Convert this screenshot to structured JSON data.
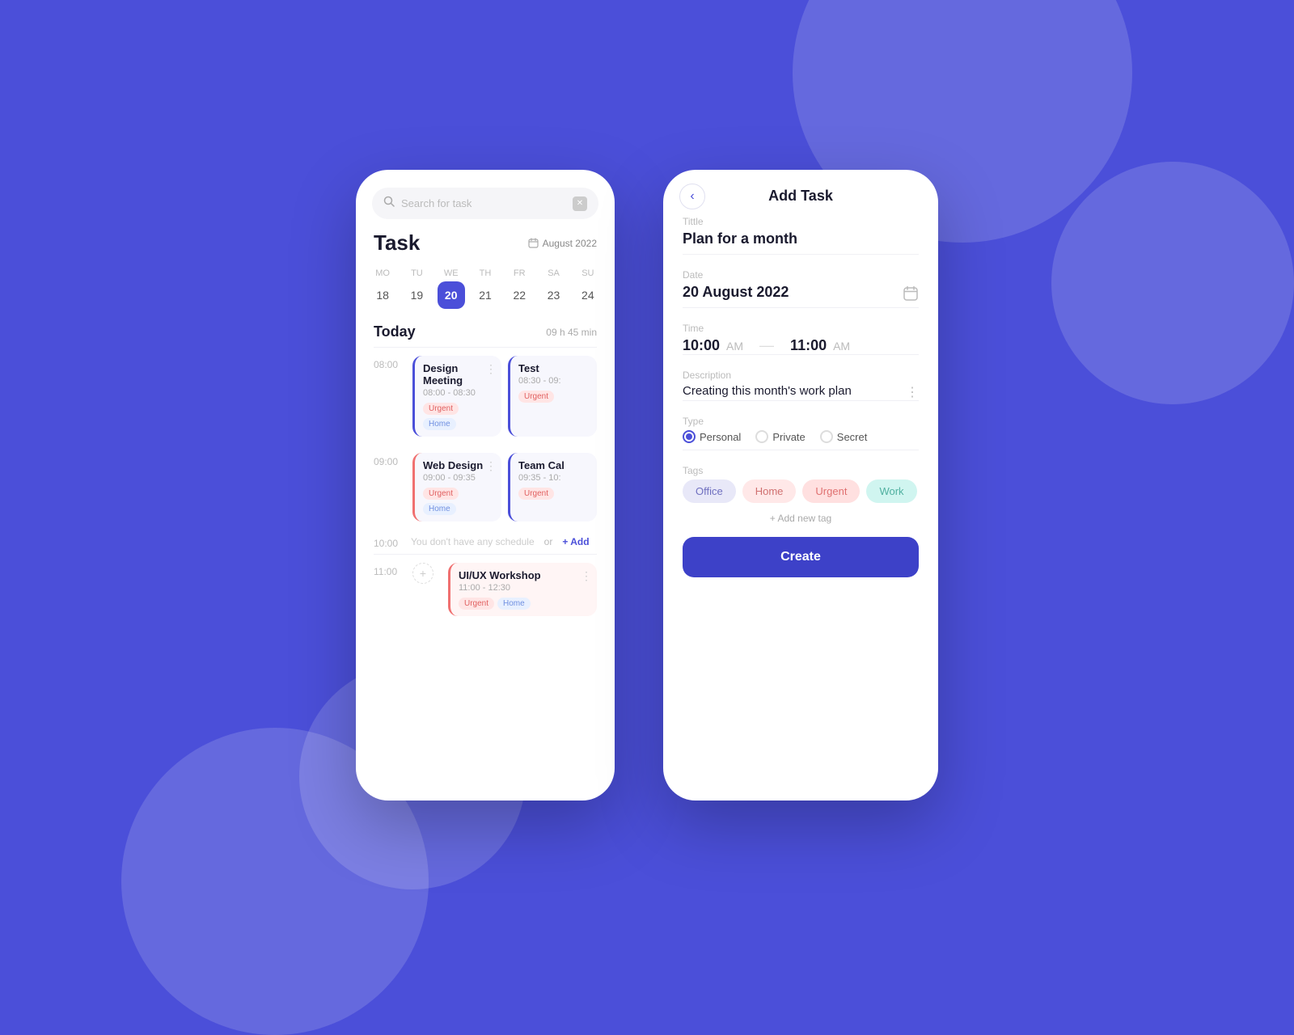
{
  "background": {
    "color": "#4B4FD9"
  },
  "leftPhone": {
    "search": {
      "placeholder": "Search for task"
    },
    "header": {
      "title": "Task",
      "month": "August 2022"
    },
    "calendar": {
      "days": [
        {
          "name": "MO",
          "num": "18",
          "active": false
        },
        {
          "name": "TU",
          "num": "19",
          "active": false
        },
        {
          "name": "WE",
          "num": "20",
          "active": true
        },
        {
          "name": "TH",
          "num": "21",
          "active": false
        },
        {
          "name": "FR",
          "num": "22",
          "active": false
        },
        {
          "name": "SA",
          "num": "23",
          "active": false
        },
        {
          "name": "SU",
          "num": "24",
          "active": false
        }
      ]
    },
    "today": {
      "label": "Today",
      "hours": "09 h 45 min"
    },
    "schedule": [
      {
        "time": "08:00",
        "tasks": [
          {
            "title": "Design Meeting",
            "timeRange": "08:00 - 08:30",
            "tags": [
              "Urgent",
              "Home"
            ],
            "borderColor": "blue"
          },
          {
            "title": "Test",
            "timeRange": "08:30 - 09:",
            "tags": [
              "Urgent"
            ],
            "borderColor": "blue"
          }
        ]
      },
      {
        "time": "09:00",
        "tasks": [
          {
            "title": "Web Design",
            "timeRange": "09:00 - 09:35",
            "tags": [
              "Urgent",
              "Home"
            ],
            "borderColor": "pink"
          },
          {
            "title": "Team Cal",
            "timeRange": "09:35 - 10:",
            "tags": [
              "Urgent"
            ],
            "borderColor": "blue"
          }
        ]
      },
      {
        "time": "10:00",
        "emptyText": "You don't have any schedule",
        "addLabel": "+ Add"
      },
      {
        "time": "11:00",
        "tasks": [
          {
            "title": "UI/UX Workshop",
            "timeRange": "11:00 - 12:30",
            "tags": [
              "Urgent",
              "Home"
            ],
            "borderColor": "pink"
          }
        ]
      }
    ]
  },
  "rightPhone": {
    "header": {
      "backIcon": "‹",
      "title": "Add Task"
    },
    "form": {
      "titleLabel": "Tittle",
      "titleValue": "Plan for a month",
      "dateLabel": "Date",
      "dateValue": "20 August 2022",
      "timeLabel": "Time",
      "timeStart": "10:00",
      "timeStartAmPm": "AM",
      "timeEnd": "11:00",
      "timeEndAmPm": "AM",
      "descLabel": "Description",
      "descValue": "Creating this month's work plan",
      "typeLabel": "Type",
      "types": [
        {
          "label": "Personal",
          "checked": true
        },
        {
          "label": "Private",
          "checked": false
        },
        {
          "label": "Secret",
          "checked": false
        }
      ],
      "tagsLabel": "Tags",
      "tags": [
        {
          "label": "Office",
          "style": "office"
        },
        {
          "label": "Home",
          "style": "home"
        },
        {
          "label": "Urgent",
          "style": "urgent"
        },
        {
          "label": "Work",
          "style": "work"
        }
      ],
      "addTagLabel": "+ Add new tag",
      "createButton": "Create"
    }
  }
}
